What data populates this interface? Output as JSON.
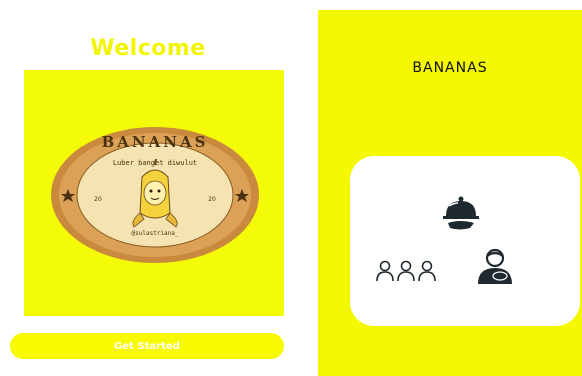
{
  "welcome_screen": {
    "title": "Welcome",
    "logo": {
      "brand": "BANANAS",
      "tagline": "Luber banget diwulut",
      "year_left": "20",
      "year_right": "20",
      "handle": "@sulastriana_"
    },
    "cta_label": "Get Started"
  },
  "home_screen": {
    "title": "BANANAS",
    "menu_items": [
      {
        "icon": "serving-dish-icon"
      },
      {
        "icon": "group-users-icon"
      },
      {
        "icon": "customer-service-icon"
      }
    ]
  },
  "colors": {
    "accent_yellow": "#f4f800",
    "title_yellow": "#f2f500",
    "badge_brown": "#c98a3d",
    "badge_inner": "#f5e3b2",
    "icon_dark": "#1e2a2f"
  }
}
